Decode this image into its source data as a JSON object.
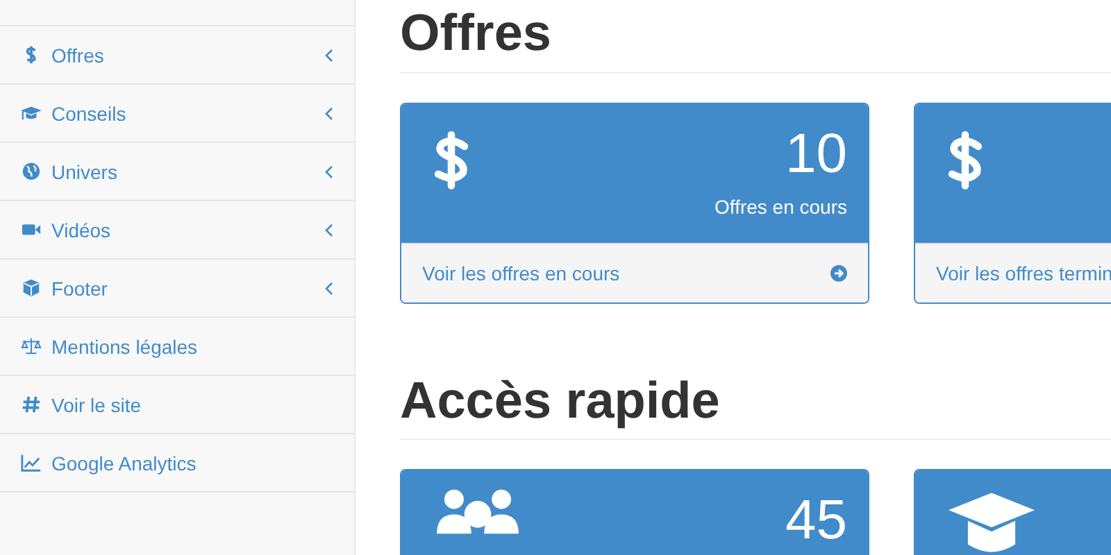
{
  "sidebar": {
    "items": [
      {
        "label": "Offres",
        "kind": "dollar",
        "has_submenu": true
      },
      {
        "label": "Conseils",
        "kind": "cap",
        "has_submenu": true
      },
      {
        "label": "Univers",
        "kind": "globe",
        "has_submenu": true
      },
      {
        "label": "Vidéos",
        "kind": "video",
        "has_submenu": true
      },
      {
        "label": "Footer",
        "kind": "cube",
        "has_submenu": true
      },
      {
        "label": "Mentions légales",
        "kind": "scale",
        "has_submenu": false
      },
      {
        "label": "Voir le site",
        "kind": "hash",
        "has_submenu": false
      },
      {
        "label": "Google Analytics",
        "kind": "chart",
        "has_submenu": false
      }
    ]
  },
  "sections": [
    {
      "title": "Offres",
      "panels": [
        {
          "kind": "dollar",
          "count": "10",
          "caption": "Offres en cours",
          "link": "Voir les offres en cours",
          "arrow": true
        },
        {
          "kind": "dollar",
          "link": "Voir les offres termin"
        }
      ]
    },
    {
      "title": "Accès rapide",
      "panels": [
        {
          "kind": "users",
          "count": "45"
        },
        {
          "kind": "cap"
        }
      ]
    }
  ]
}
